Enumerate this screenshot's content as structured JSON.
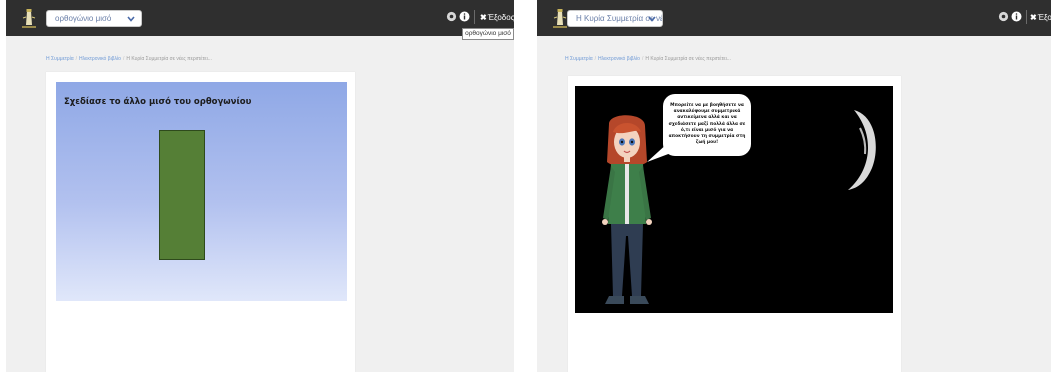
{
  "left_screen": {
    "dropdown_value": "ορθογώνιο μισό",
    "tooltip": "ορθογώνιο μισό",
    "exit_label": "Έξοδος",
    "breadcrumb": {
      "items": [
        "Η Συμμετρία",
        "Ηλεκτρονικό βιβλίο",
        "Η Κυρία Συμμετρία σε νέες περιπέτει..."
      ]
    },
    "activity_title": "Σχεδίασε το άλλο μισό του ορθογωνίου"
  },
  "right_screen": {
    "dropdown_value": "Η Κυρία Συμμετρία σε νέες...",
    "exit_label": "Έξοδο",
    "breadcrumb": {
      "items": [
        "Η Συμμετρία",
        "Ηλεκτρονικό βιβλίο",
        "Η Κυρία Συμμετρία σε νέες περιπέτει..."
      ]
    },
    "speech_text": "Μπορείτε να με βοηθήσετε να ανακαλύψουμε συμμετρικά αντικείμενα αλλά και να σχεδιάσετε μαζί πολλά άλλα σε ό,τι είναι μισό για να αποκτήσουν τη συμμετρία στη ζωή μου!"
  },
  "icons": {
    "logo": "lighthouse-logo-icon",
    "settings": "gear-icon",
    "info": "info-circle-icon",
    "close": "close-x-icon",
    "dropdown": "chevron-down-icon"
  },
  "colors": {
    "topbar": "#2f2f2f",
    "link": "#6f9ad6",
    "rectangle": "#557f36",
    "stage": "#000000"
  }
}
